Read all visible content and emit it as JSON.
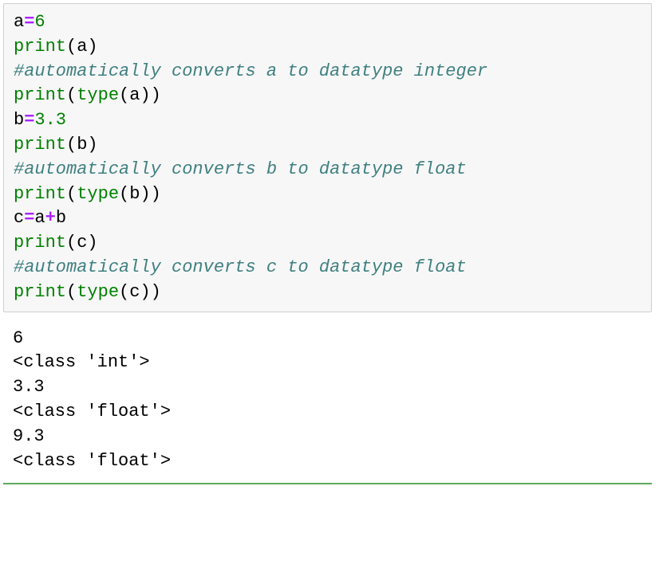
{
  "code": {
    "l1_var": "a",
    "l1_op": "=",
    "l1_val": "6",
    "l2_func": "print",
    "l2_open": "(",
    "l2_arg": "a",
    "l2_close": ")",
    "l3_comment": "#automatically converts a to datatype integer",
    "l4_func": "print",
    "l4_open": "(",
    "l4_builtin": "type",
    "l4_iopen": "(",
    "l4_arg": "a",
    "l4_iclose": ")",
    "l4_close": ")",
    "l5_var": "b",
    "l5_op": "=",
    "l5_val": "3.3",
    "l6_func": "print",
    "l6_open": "(",
    "l6_arg": "b",
    "l6_close": ")",
    "l7_comment": "#automatically converts b to datatype float",
    "l8_func": "print",
    "l8_open": "(",
    "l8_builtin": "type",
    "l8_iopen": "(",
    "l8_arg": "b",
    "l8_iclose": ")",
    "l8_close": ")",
    "l9_var": "c",
    "l9_op1": "=",
    "l9_a": "a",
    "l9_op2": "+",
    "l9_b": "b",
    "l10_func": "print",
    "l10_open": "(",
    "l10_arg": "c",
    "l10_close": ")",
    "l11_comment": "#automatically converts c to datatype float",
    "l12_func": "print",
    "l12_open": "(",
    "l12_builtin": "type",
    "l12_iopen": "(",
    "l12_arg": "c",
    "l12_iclose": ")",
    "l12_close": ")"
  },
  "output": {
    "o1": "6",
    "o2": "<class 'int'>",
    "o3": "3.3",
    "o4": "<class 'float'>",
    "o5": "9.3",
    "o6": "<class 'float'>"
  }
}
